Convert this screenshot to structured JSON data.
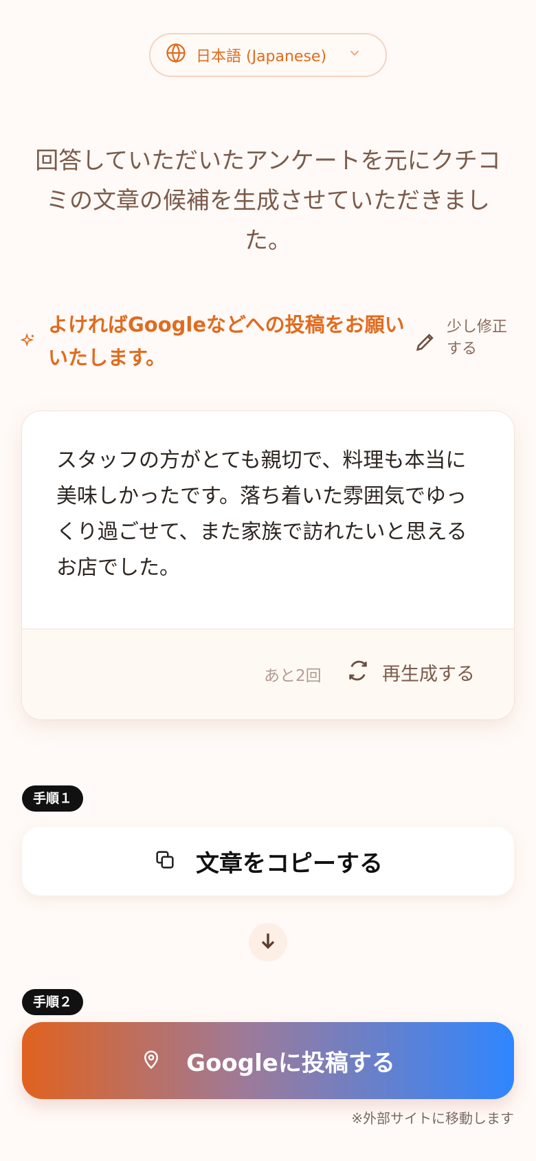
{
  "language_selector": {
    "label": "日本語 (Japanese)",
    "icon": "globe-icon"
  },
  "intro_text": "回答していただいたアンケートを元にクチコミの文章の候補を生成させていただきました。",
  "prompt": {
    "text": "よければGoogleなどへの投稿をお願いいたします。",
    "edit_label": "少し修正する"
  },
  "review": {
    "text": "スタッフの方がとても親切で、料理も本当に美味しかったです。落ち着いた雰囲気でゆっくり過ごせて、また家族で訪れたいと思えるお店でした。",
    "remaining": "あと2回",
    "regenerate_label": "再生成する"
  },
  "step1": {
    "badge": "手順１",
    "button_label": "文章をコピーする"
  },
  "step2": {
    "badge": "手順２",
    "button_label": "Googleに投稿する",
    "note": "※外部サイトに移動します"
  },
  "colors": {
    "accent": "#e06b1f",
    "brand_blue": "#2f86ff"
  }
}
